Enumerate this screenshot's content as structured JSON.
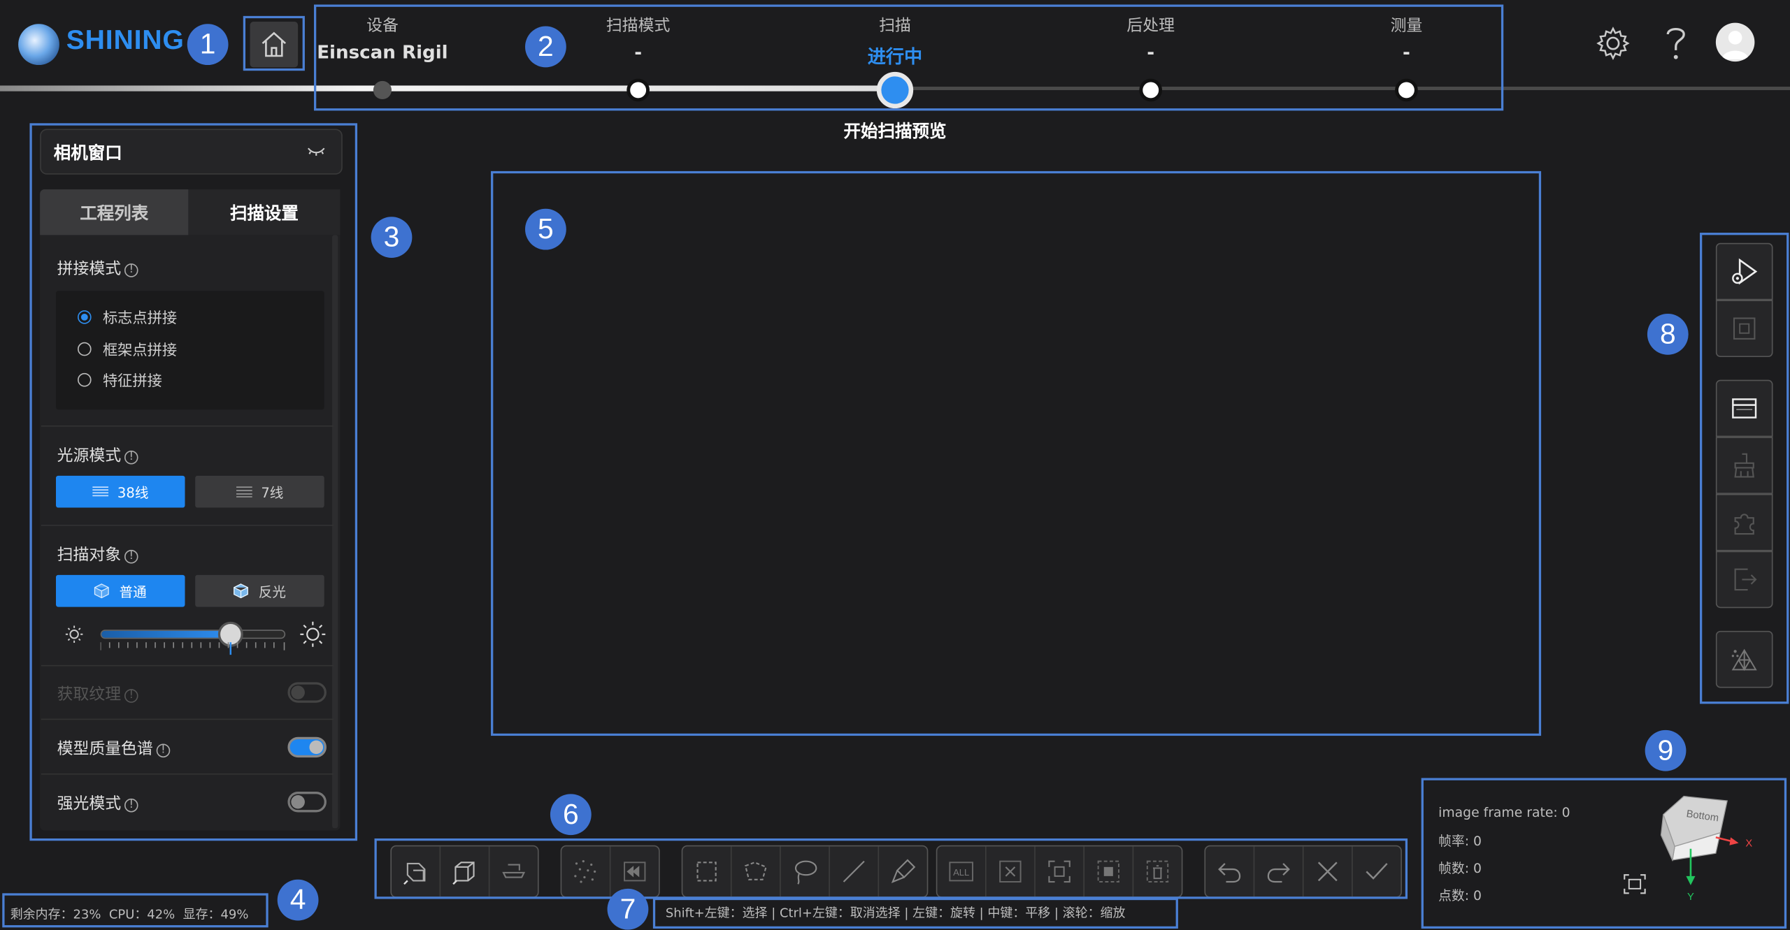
{
  "header": {
    "logo_text": "SHINING",
    "steps": [
      {
        "label": "设备",
        "value": "Einscan Rigil"
      },
      {
        "label": "扫描模式",
        "value": "-"
      },
      {
        "label": "扫描",
        "value": "进行中"
      },
      {
        "label": "后处理",
        "value": "-"
      },
      {
        "label": "测量",
        "value": "-"
      }
    ],
    "active_step": 2,
    "status_caption": "开始扫描预览"
  },
  "left_panel": {
    "camera_window_title": "相机窗口",
    "tabs": [
      "工程列表",
      "扫描设置"
    ],
    "active_tab": "扫描设置",
    "align_mode": {
      "title": "拼接模式",
      "options": [
        "标志点拼接",
        "框架点拼接",
        "特征拼接"
      ],
      "selected": "标志点拼接"
    },
    "light_mode": {
      "title": "光源模式",
      "options": [
        "38线",
        "7线"
      ],
      "selected": "38线"
    },
    "scan_object": {
      "title": "扫描对象",
      "options": [
        "普通",
        "反光"
      ],
      "selected": "普通",
      "brightness_level": 0.73
    },
    "get_texture": {
      "label": "获取纹理",
      "enabled": false,
      "on": false
    },
    "quality_map": {
      "label": "模型质量色谱",
      "on": true
    },
    "strong_light": {
      "label": "强光模式",
      "on": false
    }
  },
  "status_bar": {
    "resources": "剩余内存：23%  CPU：42%  显存：49%",
    "hint": "Shift+左键：选择 | Ctrl+左键：取消选择 | 左键：旋转 | 中键：平移 | 滚轮：缩放"
  },
  "stats": {
    "image_frame_rate": "image frame rate: 0",
    "frame_rate": "帧率: 0",
    "frame_count": "帧数: 0",
    "point_count": "点数: 0"
  },
  "view_cube": {
    "face_label": "Bottom",
    "axis_x": "X",
    "axis_y": "Y"
  },
  "annotations": [
    "1",
    "2",
    "3",
    "4",
    "5",
    "6",
    "7",
    "8",
    "9"
  ],
  "colors": {
    "accent": "#1e86f0",
    "annotation": "#3e72d0",
    "background": "#1c1c1e"
  }
}
